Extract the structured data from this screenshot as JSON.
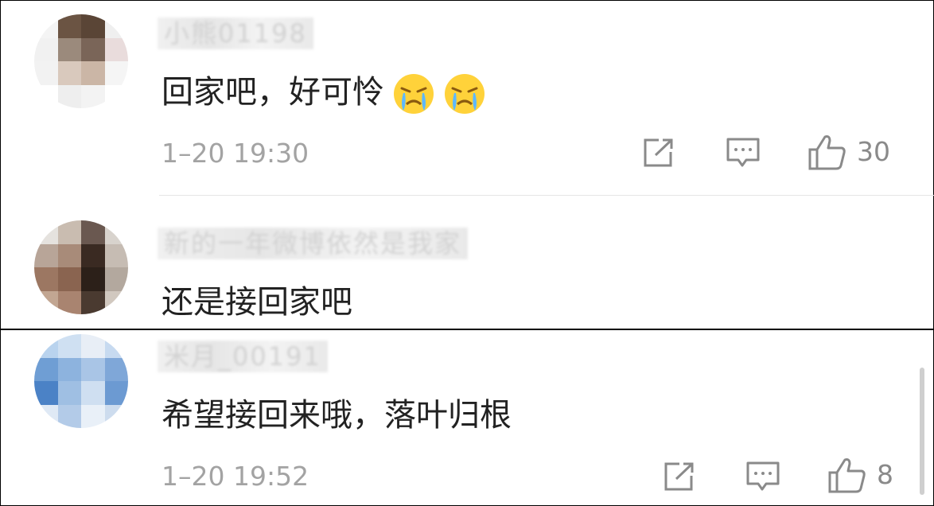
{
  "comments": [
    {
      "username": "小熊01198",
      "text": "回家吧，好可怜",
      "emojis": [
        "crying-emoji",
        "crying-emoji"
      ],
      "time": "1–20 19:30",
      "likes": "30"
    },
    {
      "username": "新的一年微博依然是我家",
      "text": "还是接回家吧"
    },
    {
      "username": "米月_00191",
      "text": "希望接回来哦，落叶归根",
      "time": "1–20 19:52",
      "likes": "8"
    }
  ],
  "icons": {
    "share": "share-icon",
    "reply": "comment-icon",
    "like": "thumbs-up-icon"
  },
  "colors": {
    "text": "#222222",
    "meta": "#a3a3a3",
    "icon": "#8a8a8a",
    "divider": "#e5e5e5"
  }
}
